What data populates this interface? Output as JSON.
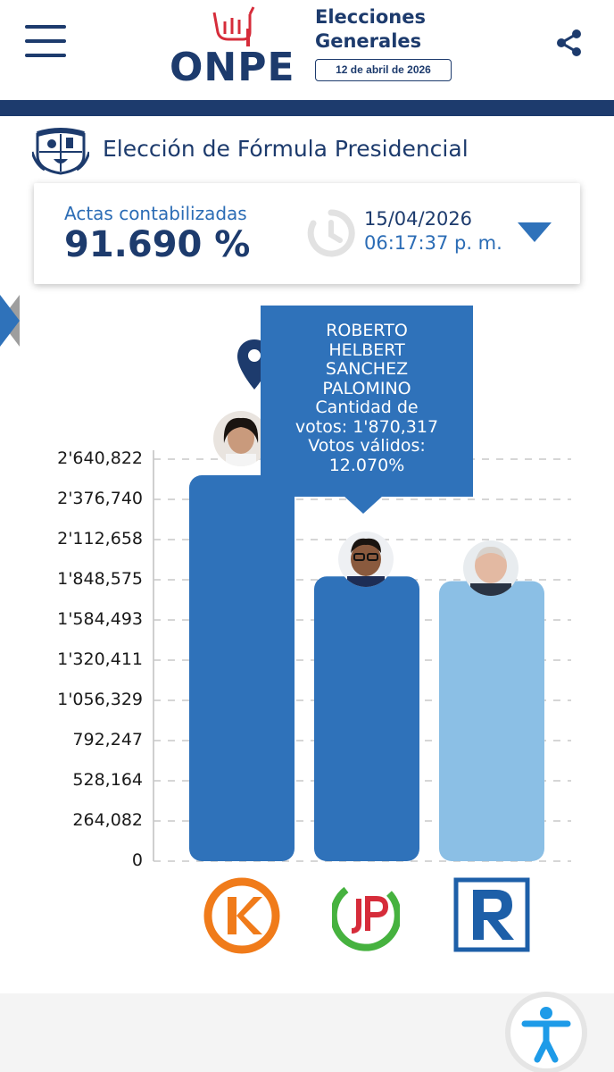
{
  "header": {
    "logo_text": "ONPE",
    "event_title_line1": "Elecciones",
    "event_title_line2": "Generales",
    "event_date": "12 de abril de 2026",
    "menu_icon": "hamburger-icon",
    "share_icon": "share-icon"
  },
  "page": {
    "title": "Elección de Fórmula Presidencial"
  },
  "stats": {
    "label": "Actas contabilizadas",
    "percentage": "91.690 %",
    "date": "15/04/2026",
    "time": "06:17:37 p. m."
  },
  "colors": {
    "primary": "#1d3b6d",
    "bar_dark": "#2f72ba",
    "bar_light": "#8bbfe5"
  },
  "tooltip": {
    "lines": [
      "ROBERTO",
      "HELBERT",
      "SANCHEZ",
      "PALOMINO",
      "Cantidad de",
      "votos: 1'870,317",
      "Votos válidos:",
      "12.070%"
    ]
  },
  "chart_data": {
    "type": "bar",
    "yticks": [
      "0",
      "264,082",
      "528,164",
      "792,247",
      "1'056,329",
      "1'320,411",
      "1'584,493",
      "1'848,575",
      "2'112,658",
      "2'376,740",
      "2'640,822"
    ],
    "ylim": [
      0,
      2640822
    ],
    "series": [
      {
        "values": [
          2535000,
          1870317,
          1840000
        ]
      }
    ],
    "bar_colors": [
      "#2f72ba",
      "#2f72ba",
      "#8bbfe5"
    ],
    "party_logos": [
      "fuerza-popular-logo",
      "juntos-por-el-peru-logo",
      "renovacion-popular-logo"
    ],
    "grid": true
  }
}
